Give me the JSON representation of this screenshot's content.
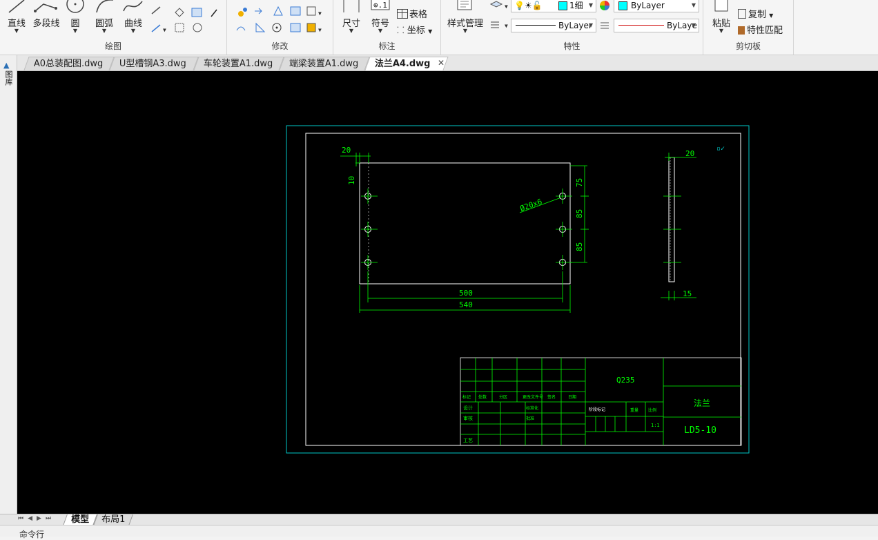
{
  "ribbon": {
    "draw_panel": {
      "title": "绘图",
      "line": "直线",
      "polyline": "多段线",
      "circle": "圆",
      "arc": "圆弧",
      "curve": "曲线"
    },
    "modify_panel": {
      "title": "修改"
    },
    "annotate_panel": {
      "title": "标注",
      "dimension": "尺寸",
      "symbol": "符号",
      "table": "表格",
      "coordinate": "坐标"
    },
    "properties_panel": {
      "title": "特性",
      "style_manager": "样式管理",
      "layer_value": "1细",
      "color_value": "ByLayer",
      "linetype_value": "ByLayer",
      "lineweight_value": "ByLaye",
      "color_swatch": "#00ffff"
    },
    "clipboard_panel": {
      "title": "剪切板",
      "paste": "粘贴",
      "copy": "复制",
      "match_props": "特性匹配"
    }
  },
  "doc_tabs": [
    {
      "label": "A0总装配图.dwg",
      "active": false
    },
    {
      "label": "U型槽钢A3.dwg",
      "active": false
    },
    {
      "label": "车轮装置A1.dwg",
      "active": false
    },
    {
      "label": "端梁装置A1.dwg",
      "active": false
    },
    {
      "label": "法兰A4.dwg",
      "active": true
    }
  ],
  "left_strip_label": "图库",
  "drawing": {
    "dims": {
      "top_left": "20",
      "left_side": "10",
      "hole_spec": "Ø20x6",
      "right_75": "75",
      "right_85a": "85",
      "right_85b": "85",
      "bottom_500": "500",
      "bottom_540": "540",
      "side_20": "20",
      "side_15": "15"
    },
    "title_block": {
      "material": "Q235",
      "part_name": "法兰",
      "drawing_no": "LD5-10",
      "rev_headers": [
        "标记",
        "处数",
        "分区",
        "更改文件号",
        "签名",
        "日期"
      ],
      "row_labels": [
        "设计",
        "审核",
        "工艺"
      ],
      "extra_labels": [
        "标准化",
        "批准"
      ],
      "stage_label": "阶段标记",
      "weight_label": "重量",
      "scale_label": "比例",
      "scale_value": "1:1"
    },
    "colors": {
      "frame": "#00c8c8",
      "geometry": "#ffffff",
      "dimension": "#00ff00"
    }
  },
  "model_tabs": [
    {
      "label": "模型",
      "active": true
    },
    {
      "label": "布局1",
      "active": false
    }
  ],
  "command_line": {
    "prompt": "命令行"
  }
}
